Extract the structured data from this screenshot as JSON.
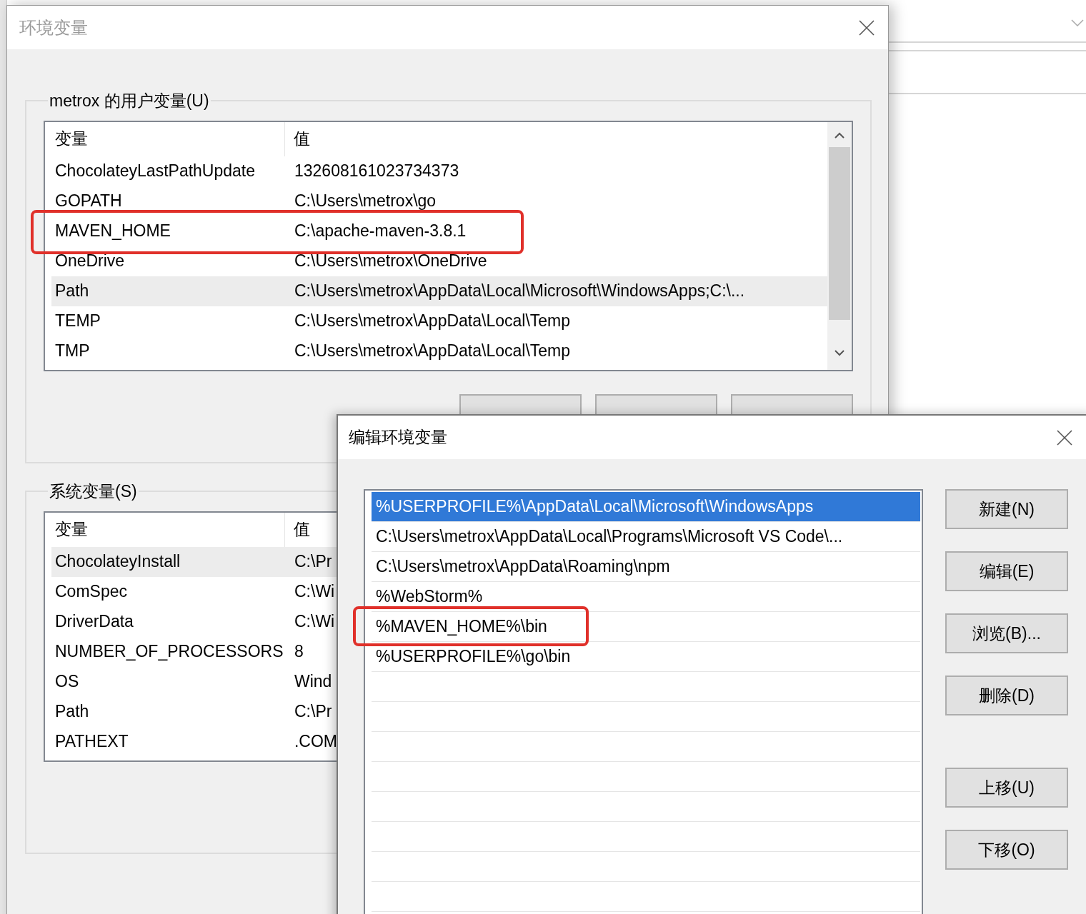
{
  "env_window": {
    "title": "环境变量",
    "user_group": {
      "label": "metrox 的用户变量(U)",
      "columns": [
        "变量",
        "值"
      ],
      "rows": [
        {
          "name": "ChocolateyLastPathUpdate",
          "value": "132608161023734373",
          "selected": false,
          "highlighted": false
        },
        {
          "name": "GOPATH",
          "value": "C:\\Users\\metrox\\go",
          "selected": false,
          "highlighted": false
        },
        {
          "name": "MAVEN_HOME",
          "value": "C:\\apache-maven-3.8.1",
          "selected": false,
          "highlighted": true
        },
        {
          "name": "OneDrive",
          "value": "C:\\Users\\metrox\\OneDrive",
          "selected": false,
          "highlighted": false
        },
        {
          "name": "Path",
          "value": "C:\\Users\\metrox\\AppData\\Local\\Microsoft\\WindowsApps;C:\\...",
          "selected": true,
          "highlighted": false
        },
        {
          "name": "TEMP",
          "value": "C:\\Users\\metrox\\AppData\\Local\\Temp",
          "selected": false,
          "highlighted": false
        },
        {
          "name": "TMP",
          "value": "C:\\Users\\metrox\\AppData\\Local\\Temp",
          "selected": false,
          "highlighted": false
        }
      ]
    },
    "system_group": {
      "label": "系统变量(S)",
      "columns": [
        "变量",
        "值"
      ],
      "rows": [
        {
          "name": "ChocolateyInstall",
          "value": "C:\\Pr",
          "selected": true
        },
        {
          "name": "ComSpec",
          "value": "C:\\Wi",
          "selected": false
        },
        {
          "name": "DriverData",
          "value": "C:\\Wi",
          "selected": false
        },
        {
          "name": "NUMBER_OF_PROCESSORS",
          "value": "8",
          "selected": false
        },
        {
          "name": "OS",
          "value": "Wind",
          "selected": false
        },
        {
          "name": "Path",
          "value": "C:\\Pr",
          "selected": false
        },
        {
          "name": "PATHEXT",
          "value": ".COM",
          "selected": false
        }
      ]
    }
  },
  "edit_window": {
    "title": "编辑环境变量",
    "entries": [
      {
        "text": "%USERPROFILE%\\AppData\\Local\\Microsoft\\WindowsApps",
        "selected": true,
        "highlighted": false
      },
      {
        "text": "C:\\Users\\metrox\\AppData\\Local\\Programs\\Microsoft VS Code\\...",
        "selected": false,
        "highlighted": false
      },
      {
        "text": "C:\\Users\\metrox\\AppData\\Roaming\\npm",
        "selected": false,
        "highlighted": false
      },
      {
        "text": "%WebStorm%",
        "selected": false,
        "highlighted": false
      },
      {
        "text": "%MAVEN_HOME%\\bin",
        "selected": false,
        "highlighted": true
      },
      {
        "text": "%USERPROFILE%\\go\\bin",
        "selected": false,
        "highlighted": false
      }
    ],
    "buttons": [
      "新建(N)",
      "编辑(E)",
      "浏览(B)...",
      "删除(D)"
    ],
    "move_buttons": [
      "上移(U)",
      "下移(O)"
    ]
  }
}
